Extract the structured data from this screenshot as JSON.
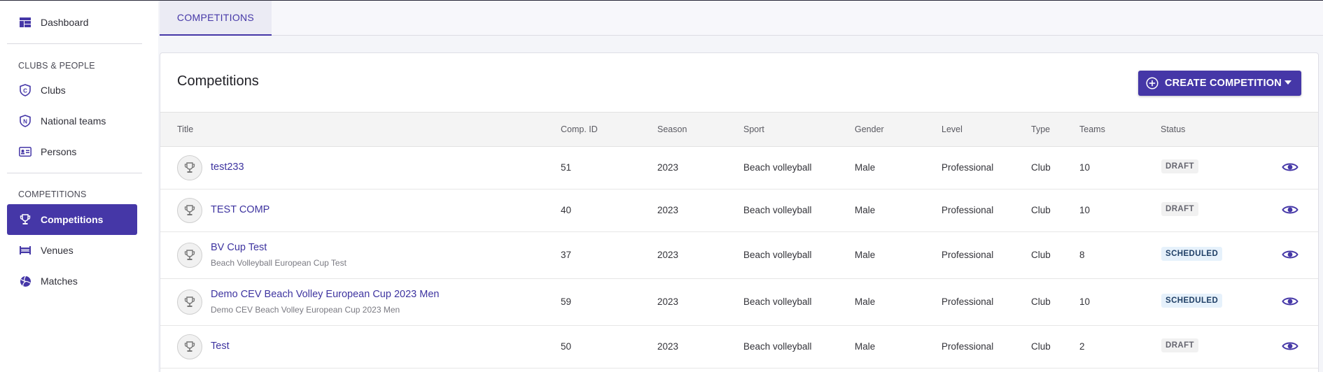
{
  "sidebar": {
    "dashboard": "Dashboard",
    "section_clubs": "CLUBS & PEOPLE",
    "clubs": "Clubs",
    "national_teams": "National teams",
    "persons": "Persons",
    "section_competitions": "COMPETITIONS",
    "competitions": "Competitions",
    "venues": "Venues",
    "matches": "Matches"
  },
  "tabs": {
    "competitions": "COMPETITIONS"
  },
  "main": {
    "title": "Competitions",
    "create_button": "CREATE COMPETITION"
  },
  "table": {
    "headers": {
      "title": "Title",
      "comp_id": "Comp. ID",
      "season": "Season",
      "sport": "Sport",
      "gender": "Gender",
      "level": "Level",
      "type": "Type",
      "teams": "Teams",
      "status": "Status"
    },
    "rows": [
      {
        "title": "test233",
        "subtitle": "",
        "comp_id": "51",
        "season": "2023",
        "sport": "Beach volleyball",
        "gender": "Male",
        "level": "Professional",
        "type": "Club",
        "teams": "10",
        "status": "DRAFT"
      },
      {
        "title": "TEST COMP",
        "subtitle": "",
        "comp_id": "40",
        "season": "2023",
        "sport": "Beach volleyball",
        "gender": "Male",
        "level": "Professional",
        "type": "Club",
        "teams": "10",
        "status": "DRAFT"
      },
      {
        "title": "BV Cup Test",
        "subtitle": "Beach Volleyball European Cup Test",
        "comp_id": "37",
        "season": "2023",
        "sport": "Beach volleyball",
        "gender": "Male",
        "level": "Professional",
        "type": "Club",
        "teams": "8",
        "status": "SCHEDULED"
      },
      {
        "title": "Demo CEV Beach Volley European Cup 2023 Men",
        "subtitle": "Demo CEV Beach Volley European Cup 2023 Men",
        "comp_id": "59",
        "season": "2023",
        "sport": "Beach volleyball",
        "gender": "Male",
        "level": "Professional",
        "type": "Club",
        "teams": "10",
        "status": "SCHEDULED"
      },
      {
        "title": "Test",
        "subtitle": "",
        "comp_id": "50",
        "season": "2023",
        "sport": "Beach volleyball",
        "gender": "Male",
        "level": "Professional",
        "type": "Club",
        "teams": "2",
        "status": "DRAFT"
      }
    ]
  },
  "colors": {
    "accent": "#4537a7",
    "draft_badge_bg": "#f1f1f1",
    "scheduled_badge_bg": "#e6f1fb"
  }
}
